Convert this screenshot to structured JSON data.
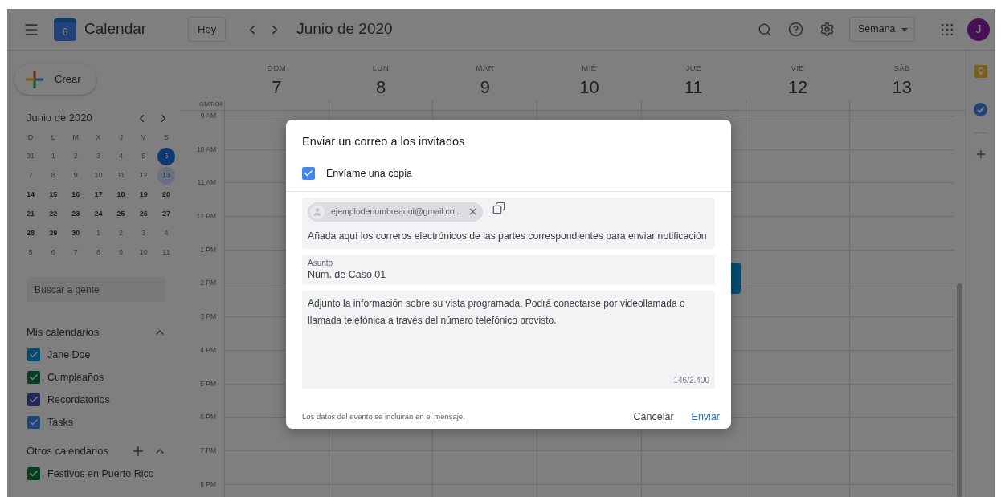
{
  "header": {
    "logo_day": "6",
    "app_name": "Calendar",
    "today_button": "Hoy",
    "period_title": "Junio de 2020",
    "view_select": "Semana",
    "avatar_letter": "J"
  },
  "create_button": "Crear",
  "mini_calendar": {
    "title": "Junio de 2020",
    "weekdays": [
      "D",
      "L",
      "M",
      "X",
      "J",
      "V",
      "S"
    ],
    "weeks": [
      {
        "days": [
          {
            "label": "31",
            "kind": "dim",
            "selected": false
          },
          {
            "label": "1",
            "kind": "dim",
            "selected": false
          },
          {
            "label": "2",
            "kind": "dim",
            "selected": false
          },
          {
            "label": "3",
            "kind": "dim",
            "selected": false
          },
          {
            "label": "4",
            "kind": "dim",
            "selected": false
          },
          {
            "label": "5",
            "kind": "dim",
            "selected": false
          },
          {
            "label": "6",
            "kind": "today",
            "selected": false
          }
        ]
      },
      {
        "days": [
          {
            "label": "7",
            "kind": "dim",
            "selected": false
          },
          {
            "label": "8",
            "kind": "dim",
            "selected": false
          },
          {
            "label": "9",
            "kind": "dim",
            "selected": false
          },
          {
            "label": "10",
            "kind": "dim",
            "selected": false
          },
          {
            "label": "11",
            "kind": "dim",
            "selected": false
          },
          {
            "label": "12",
            "kind": "dim",
            "selected": false
          },
          {
            "label": "13",
            "kind": "normal",
            "selected": true
          }
        ]
      },
      {
        "days": [
          {
            "label": "14",
            "kind": "normal",
            "selected": false
          },
          {
            "label": "15",
            "kind": "normal",
            "selected": false
          },
          {
            "label": "16",
            "kind": "normal",
            "selected": false
          },
          {
            "label": "17",
            "kind": "normal",
            "selected": false
          },
          {
            "label": "18",
            "kind": "normal",
            "selected": false
          },
          {
            "label": "19",
            "kind": "normal",
            "selected": false
          },
          {
            "label": "20",
            "kind": "normal",
            "selected": false
          }
        ]
      },
      {
        "days": [
          {
            "label": "21",
            "kind": "normal",
            "selected": false
          },
          {
            "label": "22",
            "kind": "normal",
            "selected": false
          },
          {
            "label": "23",
            "kind": "normal",
            "selected": false
          },
          {
            "label": "24",
            "kind": "normal",
            "selected": false
          },
          {
            "label": "25",
            "kind": "normal",
            "selected": false
          },
          {
            "label": "26",
            "kind": "normal",
            "selected": false
          },
          {
            "label": "27",
            "kind": "normal",
            "selected": false
          }
        ]
      },
      {
        "days": [
          {
            "label": "28",
            "kind": "normal",
            "selected": false
          },
          {
            "label": "29",
            "kind": "normal",
            "selected": false
          },
          {
            "label": "30",
            "kind": "normal",
            "selected": false
          },
          {
            "label": "1",
            "kind": "dim",
            "selected": false
          },
          {
            "label": "2",
            "kind": "dim",
            "selected": false
          },
          {
            "label": "3",
            "kind": "dim",
            "selected": false
          },
          {
            "label": "4",
            "kind": "dim",
            "selected": false
          }
        ]
      },
      {
        "days": [
          {
            "label": "5",
            "kind": "dim",
            "selected": false
          },
          {
            "label": "6",
            "kind": "dim",
            "selected": false
          },
          {
            "label": "7",
            "kind": "dim",
            "selected": false
          },
          {
            "label": "8",
            "kind": "dim",
            "selected": false
          },
          {
            "label": "9",
            "kind": "dim",
            "selected": false
          },
          {
            "label": "10",
            "kind": "dim",
            "selected": false
          },
          {
            "label": "11",
            "kind": "dim",
            "selected": false
          }
        ]
      }
    ]
  },
  "people_search": {
    "placeholder": "Buscar a gente"
  },
  "my_calendars": {
    "title": "Mis calendarios",
    "expanded": true,
    "items": [
      {
        "label": "Jane Doe",
        "checked": true,
        "color": "#024e73"
      },
      {
        "label": "Cumpleaños",
        "checked": true,
        "color": "#064022"
      },
      {
        "label": "Recordatorios",
        "checked": true,
        "color": "#20295b"
      },
      {
        "label": "Tasks",
        "checked": true,
        "color": "#21437a"
      }
    ]
  },
  "other_calendars": {
    "title": "Otros calendarios",
    "expanded": true,
    "items": [
      {
        "label": "Festivos en Puerto Rico",
        "checked": true,
        "color": "#064022"
      }
    ]
  },
  "week": {
    "timezone": "GMT-04",
    "days": [
      {
        "dow": "DOM",
        "date": "7"
      },
      {
        "dow": "LUN",
        "date": "8"
      },
      {
        "dow": "MAR",
        "date": "9"
      },
      {
        "dow": "MIÉ",
        "date": "10"
      },
      {
        "dow": "JUE",
        "date": "11"
      },
      {
        "dow": "VIE",
        "date": "12"
      },
      {
        "dow": "SÁB",
        "date": "13"
      }
    ],
    "hours": [
      "9 AM",
      "10 AM",
      "11 AM",
      "12 PM",
      "1 PM",
      "2 PM",
      "3 PM",
      "4 PM",
      "5 PM",
      "6 PM",
      "7 PM",
      "8 PM"
    ]
  },
  "dialog": {
    "title": "Enviar un correo a los invitados",
    "copy_to_me": {
      "label": "Envíame una copia",
      "checked": true
    },
    "recipients": [
      {
        "email": "ejemplodenombreaqui@gmail.co..."
      }
    ],
    "recipients_field": {
      "placeholder": "Añada aquí los correros electrónicos de las partes correspondientes para enviar notificación"
    },
    "subject": {
      "label": "Asunto",
      "value": "Núm. de Caso 01"
    },
    "message": {
      "value": "Adjunto la información sobre su vista programada. Podrá conectarse por videollamada o llamada telefónica a través del número telefónico provisto.",
      "counter": "146/2.400"
    },
    "note": "Los datos del evento se incluirán en el mensaje.",
    "cancel": "Cancelar",
    "send": "Enviar"
  }
}
